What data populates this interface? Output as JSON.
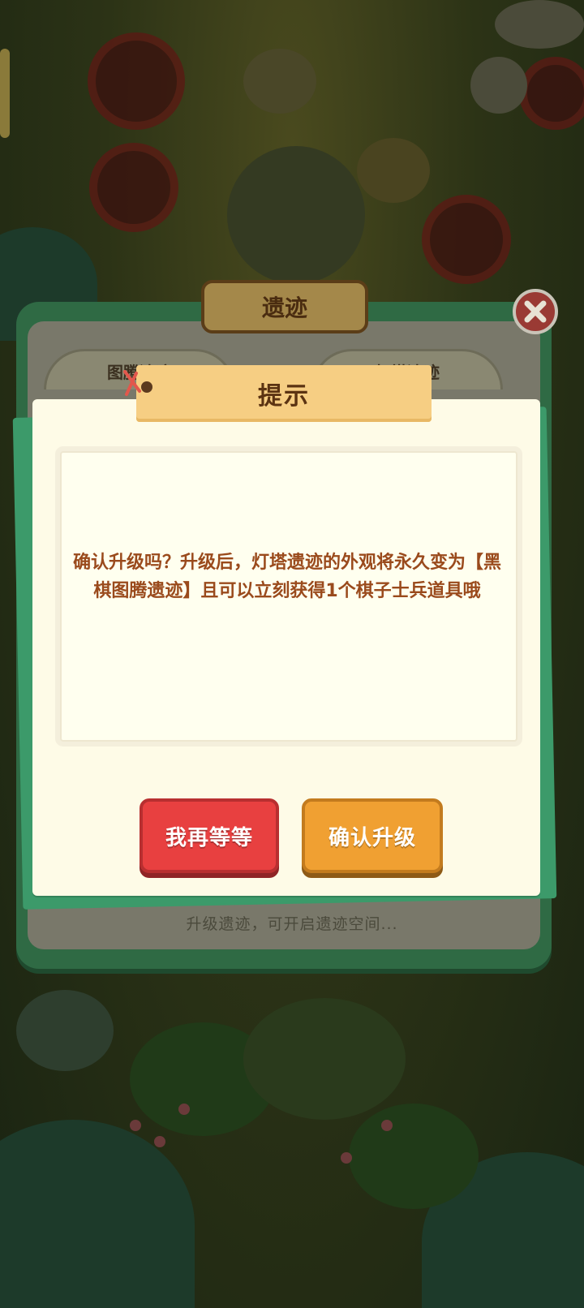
{
  "background_panel": {
    "title": "遗迹",
    "tab_left": "图腾遗迹",
    "tab_right": "灯塔遗迹",
    "footer_text": "升级遗迹，可开启遗迹空间..."
  },
  "dialog": {
    "title": "提示",
    "message": "确认升级吗？升级后，灯塔遗迹的外观将永久变为【黑棋图腾遗迹】且可以立刻获得1个棋子士兵道具哦",
    "cancel_label": "我再等等",
    "confirm_label": "确认升级"
  },
  "icons": {
    "close": "close-x-icon"
  },
  "colors": {
    "cancel_button": "#e84040",
    "confirm_button": "#f0a032",
    "message_text": "#9a4a1c",
    "title_banner": "#f6ce83"
  }
}
